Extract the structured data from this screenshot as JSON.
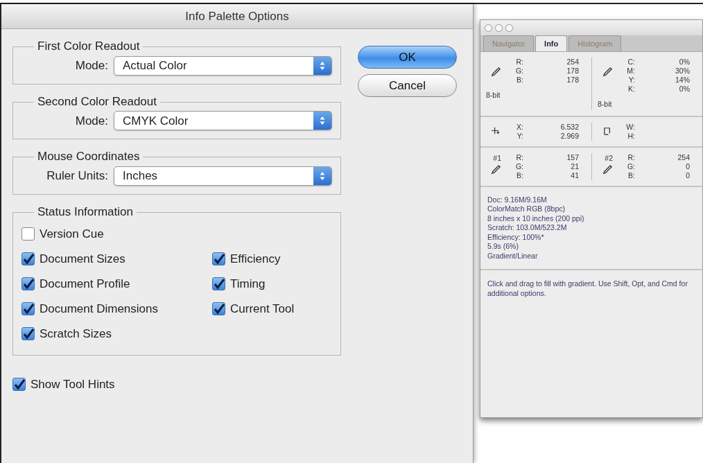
{
  "dialog": {
    "title": "Info Palette Options",
    "groups": [
      {
        "title": "First Color Readout",
        "field_label": "Mode:",
        "value": "Actual Color"
      },
      {
        "title": "Second Color Readout",
        "field_label": "Mode:",
        "value": "CMYK Color"
      },
      {
        "title": "Mouse Coordinates",
        "field_label": "Ruler Units:",
        "value": "Inches"
      }
    ],
    "status": {
      "title": "Status Information",
      "left_options": [
        {
          "label": "Version Cue",
          "checked": false
        },
        {
          "label": "Document Sizes",
          "checked": true
        },
        {
          "label": "Document Profile",
          "checked": true
        },
        {
          "label": "Document Dimensions",
          "checked": true
        },
        {
          "label": "Scratch Sizes",
          "checked": true
        }
      ],
      "right_options": [
        {
          "label": "Efficiency",
          "checked": true
        },
        {
          "label": "Timing",
          "checked": true
        },
        {
          "label": "Current Tool",
          "checked": true
        }
      ]
    },
    "show_tool_hints": {
      "label": "Show Tool Hints",
      "checked": true
    },
    "buttons": [
      {
        "label": "OK",
        "default": true
      },
      {
        "label": "Cancel",
        "default": false
      }
    ]
  },
  "palette": {
    "tabs": [
      {
        "label": "Navigator",
        "selected": false
      },
      {
        "label": "Info",
        "selected": true
      },
      {
        "label": "Histogram",
        "selected": false
      }
    ],
    "sections": [
      {
        "left": {
          "kind": "eyedropper",
          "rows": [
            {
              "label": "R:",
              "value": "254"
            },
            {
              "label": "G:",
              "value": "178"
            },
            {
              "label": "B:",
              "value": "178"
            }
          ],
          "bits": "8-bit"
        },
        "right": {
          "kind": "eyedropper",
          "rows": [
            {
              "label": "C:",
              "value": "0%"
            },
            {
              "label": "M:",
              "value": "30%"
            },
            {
              "label": "Y:",
              "value": "14%"
            },
            {
              "label": "K:",
              "value": "0%"
            }
          ],
          "bits": "8-bit"
        }
      },
      {
        "left": {
          "kind": "crosshair",
          "rows": [
            {
              "label": "X:",
              "value": "6.532"
            },
            {
              "label": "Y:",
              "value": "2.969"
            }
          ]
        },
        "right": {
          "kind": "marquee",
          "rows": [
            {
              "label": "W:",
              "value": ""
            },
            {
              "label": "H:",
              "value": ""
            }
          ]
        }
      },
      {
        "left": {
          "kind": "eyedropper",
          "sampler": "#1",
          "rows": [
            {
              "label": "R:",
              "value": "157"
            },
            {
              "label": "G:",
              "value": "21"
            },
            {
              "label": "B:",
              "value": "41"
            }
          ]
        },
        "right": {
          "kind": "eyedropper",
          "sampler": "#2",
          "rows": [
            {
              "label": "R:",
              "value": "254"
            },
            {
              "label": "G:",
              "value": "0"
            },
            {
              "label": "B:",
              "value": "0"
            }
          ]
        }
      }
    ],
    "status_lines": [
      "Doc: 9.16M/9.16M",
      "ColorMatch RGB (8bpc)",
      "8 inches x 10 inches (200 ppi)",
      "Scratch: 103.0M/523.2M",
      "Efficiency: 100%*",
      "5.9s (6%)",
      "Gradient/Linear"
    ],
    "hint": "Click and drag to fill with gradient.  Use Shift, Opt, and Cmd for additional options."
  }
}
